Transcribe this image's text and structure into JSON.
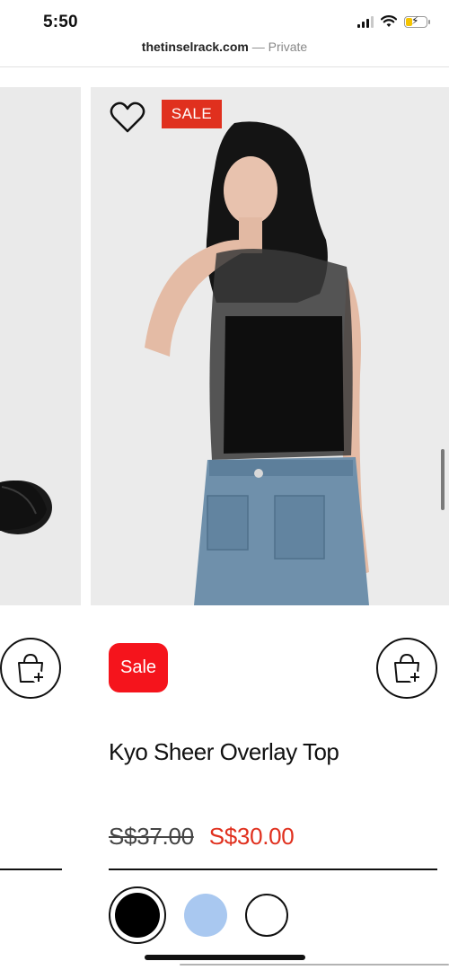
{
  "status_bar": {
    "time": "5:50",
    "signal_icon": "cellular-signal-icon",
    "wifi_icon": "wifi-icon",
    "battery_icon": "battery-charging-icon",
    "battery_level": 0.3,
    "battery_color": "#f5c400"
  },
  "browser": {
    "domain": "thetinselrack.com",
    "separator": "—",
    "mode": "Private"
  },
  "product": {
    "sale_tag": "SALE",
    "sale_badge": "Sale",
    "name": "Kyo Sheer Overlay Top",
    "price_original": "S$37.00",
    "price_sale": "S$30.00",
    "wishlist_icon": "heart-outline-icon",
    "cart_icon": "shopping-bag-plus-icon",
    "swatches": [
      {
        "color": "#000000",
        "selected": true
      },
      {
        "color": "#a9c8f0",
        "selected": false
      },
      {
        "color": "#ffffff",
        "selected": false
      }
    ]
  },
  "colors": {
    "sale_red": "#e0301e",
    "badge_red": "#f5141c",
    "text": "#111111"
  }
}
